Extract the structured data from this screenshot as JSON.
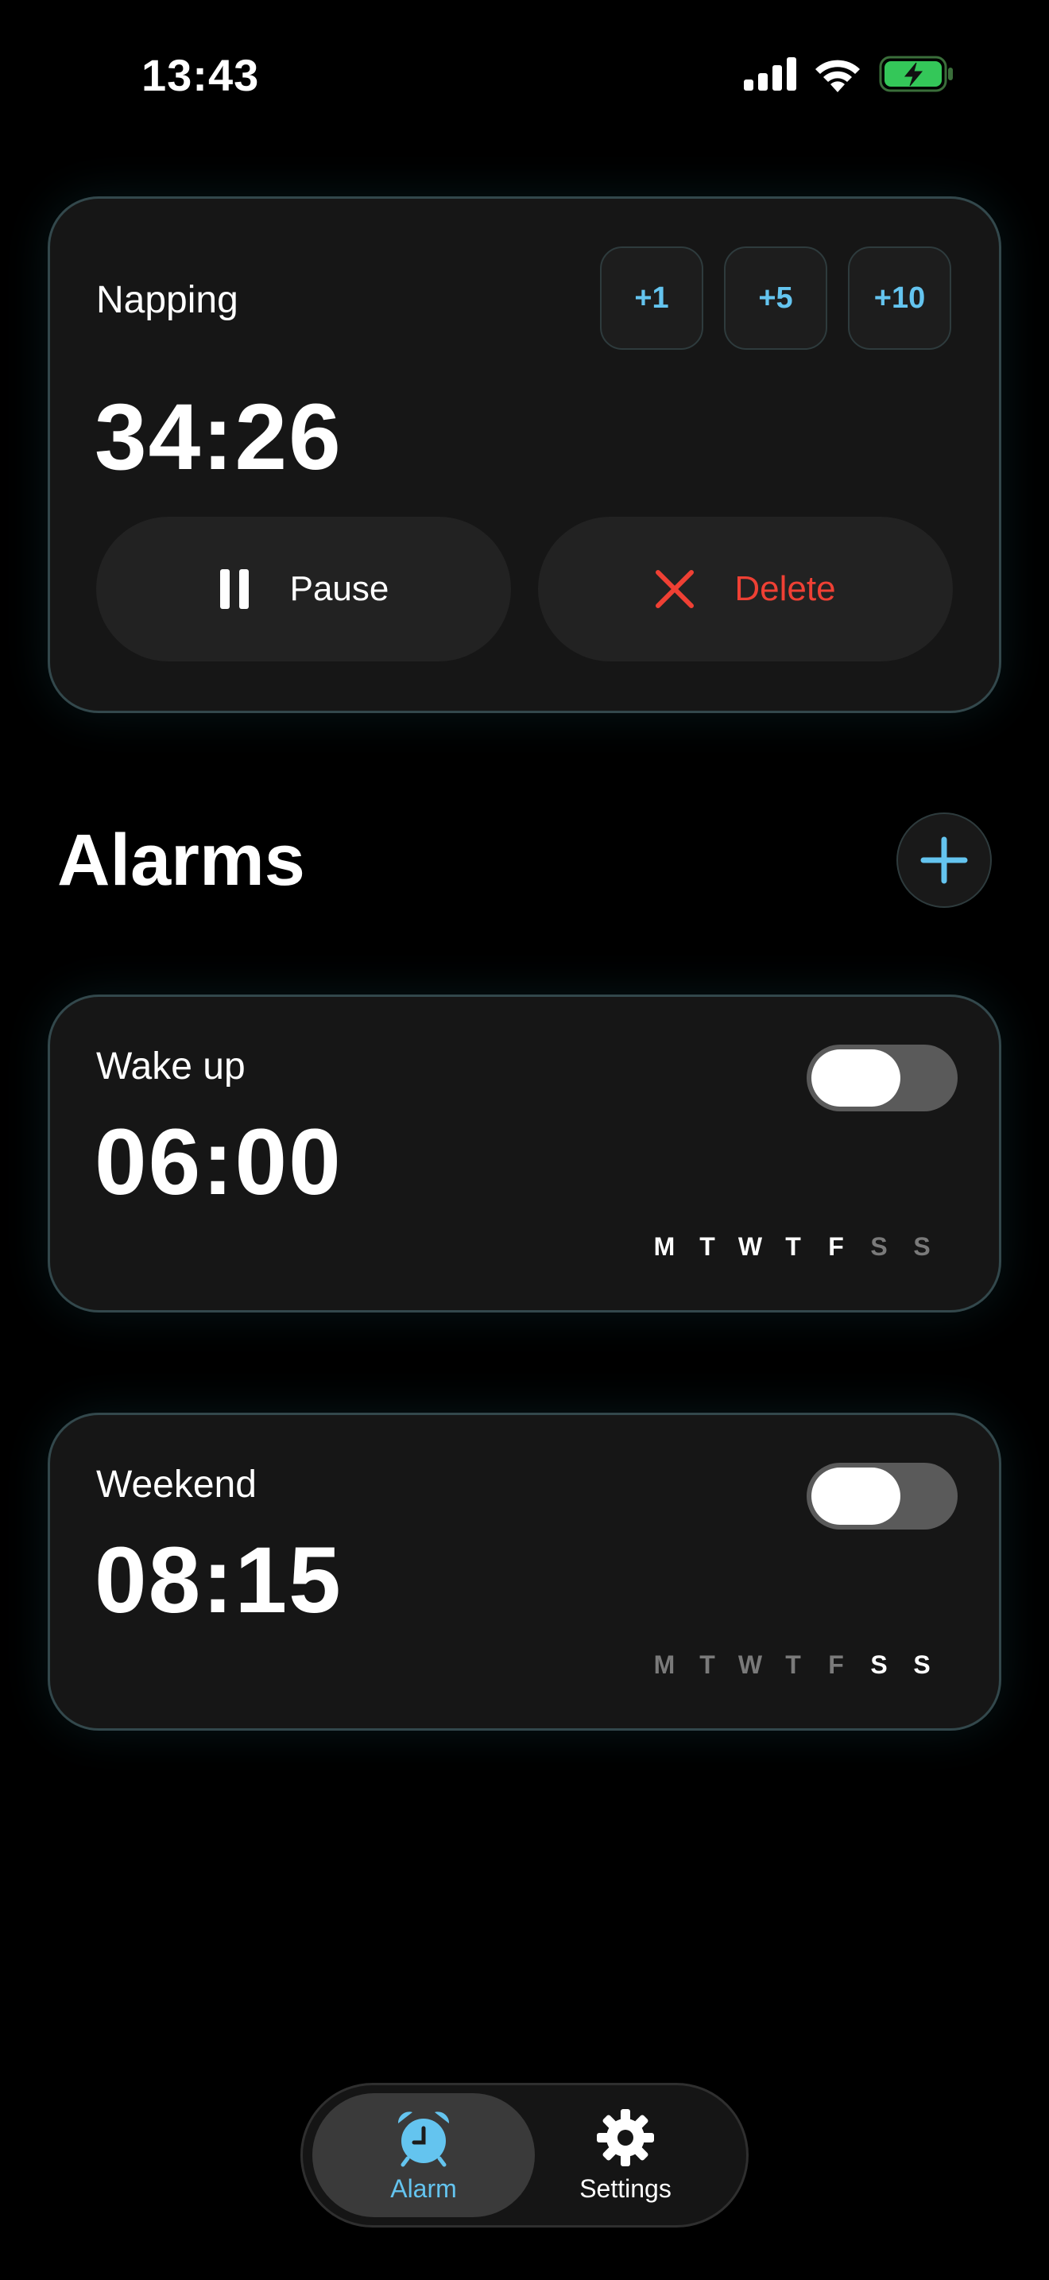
{
  "status_bar": {
    "time": "13:43",
    "icons": [
      "signal-icon",
      "wifi-icon",
      "battery-charging-icon"
    ]
  },
  "nap": {
    "title": "Napping",
    "time": "34:26",
    "increments": [
      "+1",
      "+5",
      "+10"
    ],
    "pause_label": "Pause",
    "delete_label": "Delete"
  },
  "alarms": {
    "title": "Alarms",
    "items": [
      {
        "label": "Wake up",
        "time": "06:00",
        "enabled": false,
        "days": [
          "M",
          "T",
          "W",
          "T",
          "F",
          "S",
          "S"
        ],
        "active_days": [
          true,
          true,
          true,
          true,
          true,
          false,
          false
        ]
      },
      {
        "label": "Weekend",
        "time": "08:15",
        "enabled": false,
        "days": [
          "M",
          "T",
          "W",
          "T",
          "F",
          "S",
          "S"
        ],
        "active_days": [
          false,
          false,
          false,
          false,
          false,
          true,
          true
        ]
      }
    ]
  },
  "tab_bar": {
    "tabs": [
      {
        "label": "Alarm",
        "icon": "alarm-clock-icon",
        "active": true
      },
      {
        "label": "Settings",
        "icon": "gear-icon",
        "active": false
      }
    ]
  },
  "colors": {
    "accent": "#64c4ef",
    "danger": "#ef4034",
    "battery": "#34c759",
    "card_border": "#33484c"
  }
}
